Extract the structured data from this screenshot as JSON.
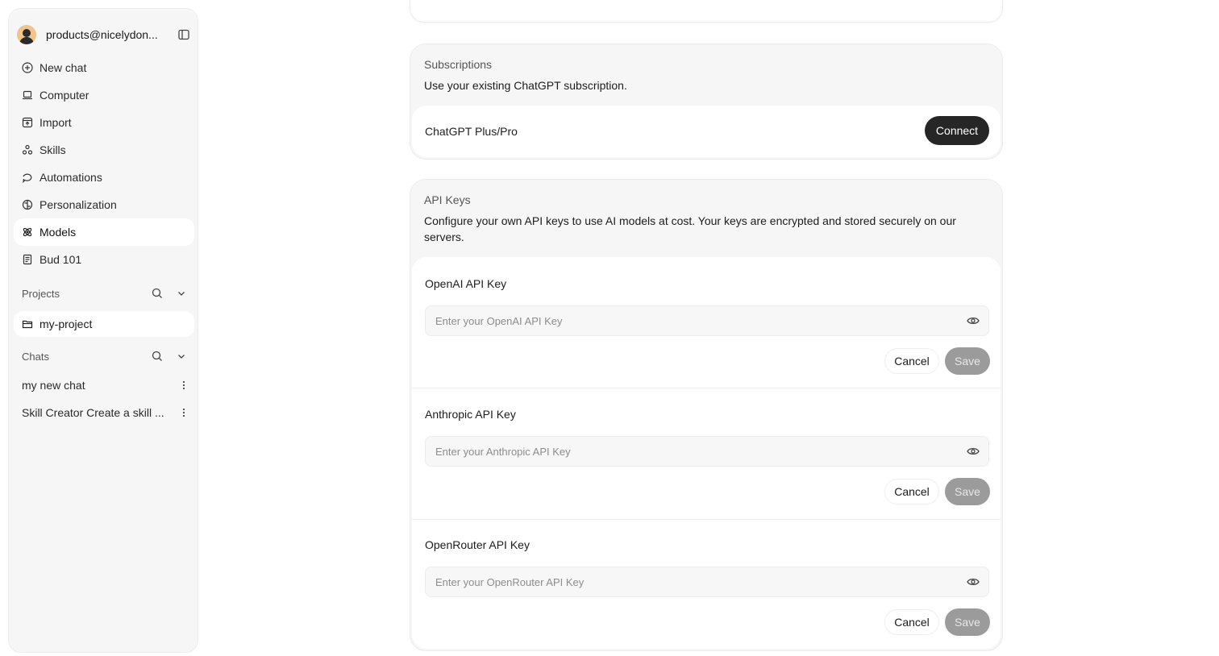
{
  "sidebar": {
    "account": {
      "email": "products@nicelydon...",
      "icons": {
        "avatar": "avatar",
        "collapse": "sidebar-toggle-icon"
      }
    },
    "nav": [
      {
        "label": "New chat",
        "icon": "plus-circle-icon",
        "active": false
      },
      {
        "label": "Computer",
        "icon": "laptop-icon",
        "active": false
      },
      {
        "label": "Import",
        "icon": "import-icon",
        "active": false
      },
      {
        "label": "Skills",
        "icon": "skills-icon",
        "active": false
      },
      {
        "label": "Automations",
        "icon": "automation-icon",
        "active": false
      },
      {
        "label": "Personalization",
        "icon": "brain-icon",
        "active": false
      },
      {
        "label": "Models",
        "icon": "atom-icon",
        "active": true
      },
      {
        "label": "Bud 101",
        "icon": "book-icon",
        "active": false
      }
    ],
    "projects": {
      "title": "Projects",
      "items": [
        {
          "label": "my-project"
        }
      ]
    },
    "chats": {
      "title": "Chats",
      "items": [
        {
          "label": "my new chat"
        },
        {
          "label": "Skill Creator Create a skill ..."
        }
      ]
    }
  },
  "main": {
    "subscriptions": {
      "label": "Subscriptions",
      "description": "Use your existing ChatGPT subscription.",
      "item": "ChatGPT Plus/Pro",
      "connect_label": "Connect"
    },
    "api_keys": {
      "label": "API Keys",
      "description": "Configure your own API keys to use AI models at cost. Your keys are encrypted and stored securely on our servers.",
      "keys": [
        {
          "title": "OpenAI API Key",
          "placeholder": "Enter your OpenAI API Key",
          "value": "",
          "cancel": "Cancel",
          "save": "Save"
        },
        {
          "title": "Anthropic API Key",
          "placeholder": "Enter your Anthropic API Key",
          "value": "",
          "cancel": "Cancel",
          "save": "Save"
        },
        {
          "title": "OpenRouter API Key",
          "placeholder": "Enter your OpenRouter API Key",
          "value": "",
          "cancel": "Cancel",
          "save": "Save"
        }
      ]
    }
  },
  "colors": {
    "accent_dark": "#262626",
    "save_disabled": "#9b9b9b",
    "sidebar_bg": "#f6f6f6"
  }
}
